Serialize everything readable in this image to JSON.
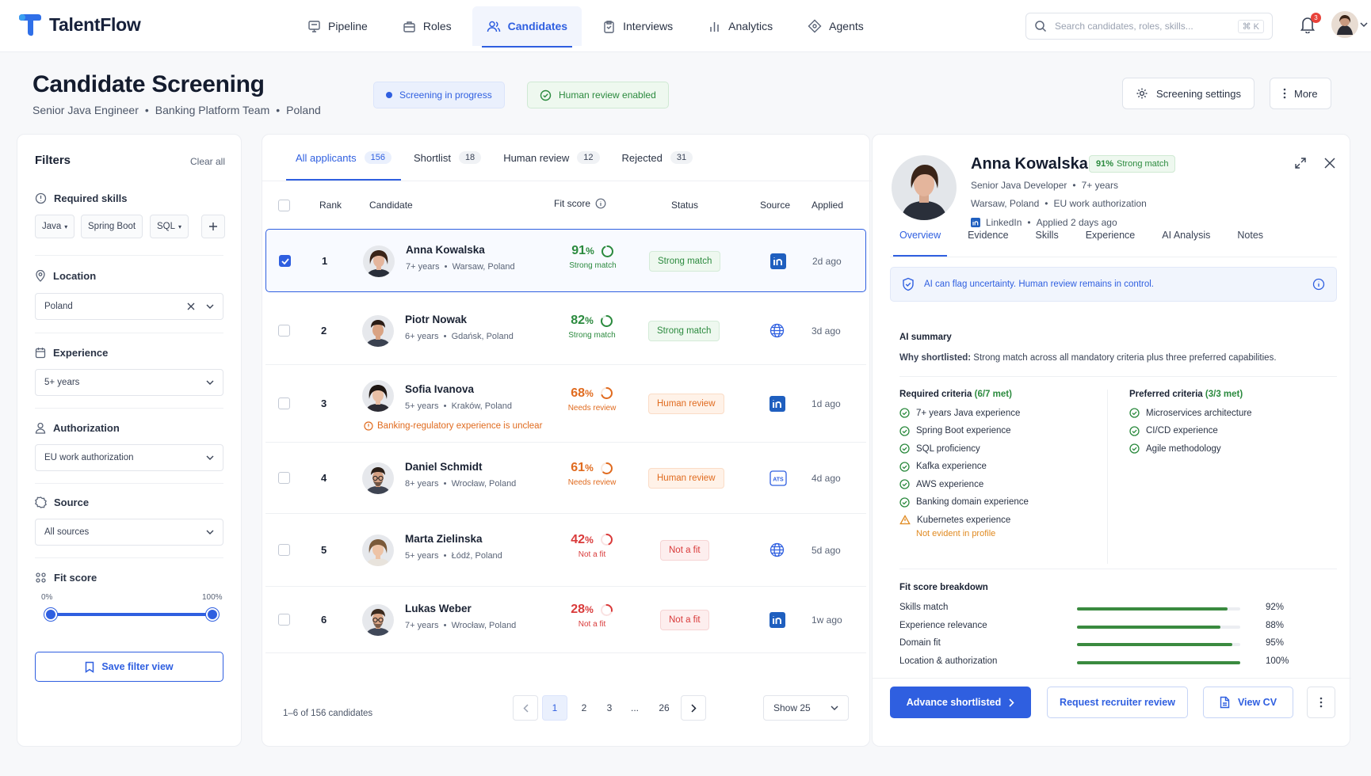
{
  "app": {
    "name": "TalentFlow"
  },
  "nav": [
    {
      "label": "Pipeline",
      "icon": "pipeline-icon"
    },
    {
      "label": "Roles",
      "icon": "briefcase-icon"
    },
    {
      "label": "Candidates",
      "icon": "users-icon",
      "active": true
    },
    {
      "label": "Interviews",
      "icon": "clipboard-icon"
    },
    {
      "label": "Analytics",
      "icon": "bar-chart-icon"
    },
    {
      "label": "Agents",
      "icon": "diamond-icon"
    }
  ],
  "search": {
    "placeholder": "Search candidates, roles, skills...",
    "shortcut": "⌘ K"
  },
  "notifications": {
    "count": "3"
  },
  "header": {
    "title": "Candidate Screening",
    "subtitle": [
      "Senior Java Engineer",
      "Banking Platform Team",
      "Poland"
    ],
    "status_pill": "Screening in progress",
    "review_pill": "Human review enabled",
    "settings_button": "Screening settings",
    "more_button": "More"
  },
  "filters": {
    "title": "Filters",
    "clear": "Clear all",
    "skills_label": "Required skills",
    "skills": [
      "Java",
      "Spring Boot",
      "SQL"
    ],
    "location_label": "Location",
    "location_value": "Poland",
    "experience_label": "Experience",
    "experience_value": "5+ years",
    "authorization_label": "Authorization",
    "authorization_value": "EU work authorization",
    "source_label": "Source",
    "source_value": "All sources",
    "fit_label": "Fit score",
    "fit_min": "0%",
    "fit_max": "100%",
    "fit_range": [
      0,
      100
    ],
    "save_button": "Save filter view"
  },
  "table": {
    "tabs": [
      {
        "label": "All applicants",
        "count": "156",
        "active": true
      },
      {
        "label": "Shortlist",
        "count": "18"
      },
      {
        "label": "Human review",
        "count": "12"
      },
      {
        "label": "Rejected",
        "count": "31"
      }
    ],
    "columns": {
      "rank": "Rank",
      "candidate": "Candidate",
      "fit": "Fit score",
      "status": "Status",
      "source": "Source",
      "applied": "Applied"
    },
    "rows": [
      {
        "rank": "1",
        "name": "Anna Kowalska",
        "years": "7+ years",
        "location": "Warsaw, Poland",
        "score": "91",
        "score_label": "Strong match",
        "status": "Strong match",
        "kind": "green",
        "source": "linkedin",
        "applied": "2d ago",
        "selected": true
      },
      {
        "rank": "2",
        "name": "Piotr Nowak",
        "years": "6+ years",
        "location": "Gdańsk, Poland",
        "score": "82",
        "score_label": "Strong match",
        "status": "Strong match",
        "kind": "green",
        "source": "web",
        "applied": "3d ago"
      },
      {
        "rank": "3",
        "name": "Sofia Ivanova",
        "years": "5+ years",
        "location": "Kraków, Poland",
        "score": "68",
        "score_label": "Needs review",
        "status": "Human review",
        "kind": "orange",
        "source": "linkedin",
        "applied": "1d ago",
        "warning": "Banking-regulatory experience is unclear"
      },
      {
        "rank": "4",
        "name": "Daniel Schmidt",
        "years": "8+ years",
        "location": "Wrocław, Poland",
        "score": "61",
        "score_label": "Needs review",
        "status": "Human review",
        "kind": "orange",
        "source": "ats",
        "applied": "4d ago"
      },
      {
        "rank": "5",
        "name": "Marta Zielinska",
        "years": "5+ years",
        "location": "Łódź, Poland",
        "score": "42",
        "score_label": "Not a fit",
        "status": "Not a fit",
        "kind": "red",
        "source": "web",
        "applied": "5d ago"
      },
      {
        "rank": "6",
        "name": "Lukas Weber",
        "years": "7+ years",
        "location": "Wrocław, Poland",
        "score": "28",
        "score_label": "Not a fit",
        "status": "Not a fit",
        "kind": "red",
        "source": "linkedin",
        "applied": "1w ago"
      }
    ],
    "summary": "1–6 of 156 candidates",
    "pages": [
      "1",
      "2",
      "3",
      "...",
      "26"
    ],
    "page_size": "Show 25",
    "ats_label": "ATS"
  },
  "detail": {
    "name": "Anna Kowalska",
    "match_pct": "91%",
    "match_label": "Strong match",
    "role": "Senior Java Developer",
    "years": "7+ years",
    "location": "Warsaw, Poland",
    "authorization": "EU work authorization",
    "source": "LinkedIn",
    "applied": "Applied 2 days ago",
    "tabs": [
      "Overview",
      "Evidence",
      "Skills",
      "Experience",
      "AI Analysis",
      "Notes"
    ],
    "notice": "AI can flag uncertainty. Human review remains in control.",
    "summary_title": "AI summary",
    "why_label": "Why shortlisted:",
    "why_text": "Strong match across all mandatory criteria plus three preferred capabilities.",
    "required_title": "Required criteria",
    "required_count": "(6/7 met)",
    "required": [
      {
        "label": "7+ years Java experience",
        "ok": true
      },
      {
        "label": "Spring Boot experience",
        "ok": true
      },
      {
        "label": "SQL proficiency",
        "ok": true
      },
      {
        "label": "Kafka experience",
        "ok": true
      },
      {
        "label": "AWS experience",
        "ok": true
      },
      {
        "label": "Banking domain experience",
        "ok": true
      },
      {
        "label": "Kubernetes experience",
        "ok": false,
        "note": "Not evident in profile"
      }
    ],
    "preferred_title": "Preferred criteria",
    "preferred_count": "(3/3 met)",
    "preferred": [
      "Microservices architecture",
      "CI/CD experience",
      "Agile methodology"
    ],
    "breakdown_title": "Fit score breakdown",
    "breakdown": [
      {
        "label": "Skills match",
        "value": 92,
        "text": "92%"
      },
      {
        "label": "Experience relevance",
        "value": 88,
        "text": "88%"
      },
      {
        "label": "Domain fit",
        "value": 95,
        "text": "95%"
      },
      {
        "label": "Location & authorization",
        "value": 100,
        "text": "100%"
      }
    ],
    "advance_button": "Advance shortlisted",
    "review_button": "Request recruiter review",
    "cv_button": "View CV"
  },
  "colors": {
    "accent": "#2f5fe0",
    "green": "#2b8a3e",
    "orange": "#e06b1f",
    "red": "#d93a3a"
  }
}
